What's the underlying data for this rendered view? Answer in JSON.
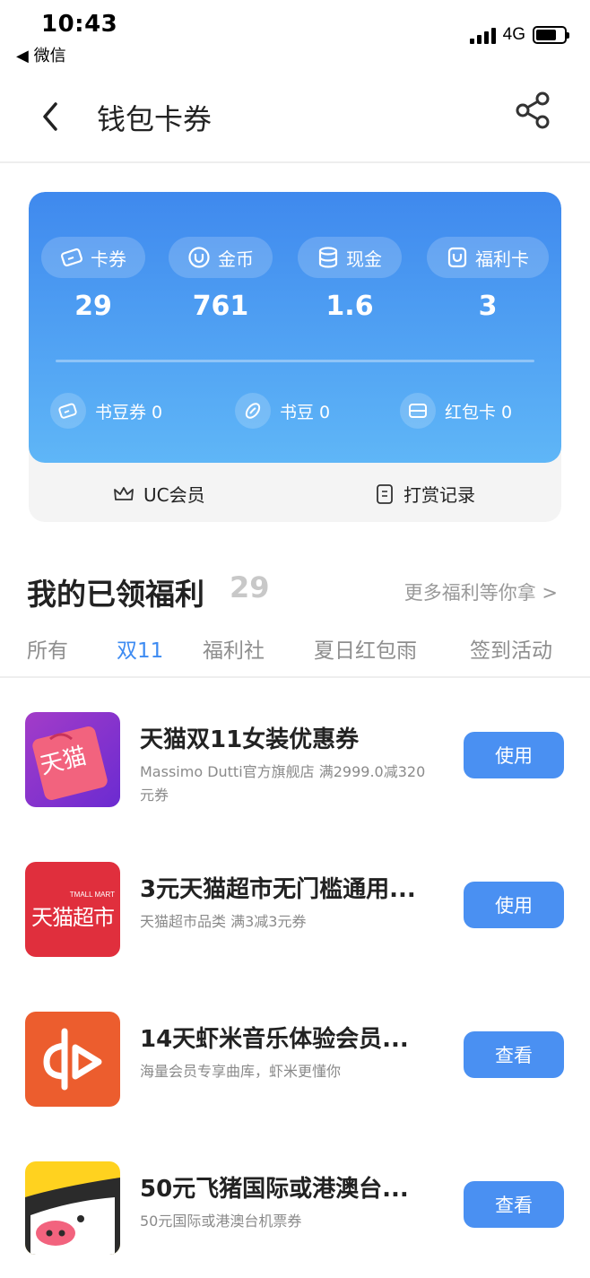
{
  "status_bar": {
    "time": "10:43",
    "back_app": "◀ 微信",
    "network": "4G"
  },
  "nav": {
    "title": "钱包卡券"
  },
  "summary": {
    "stats": [
      {
        "label": "卡券",
        "value": "29",
        "icon": "ticket-icon"
      },
      {
        "label": "金币",
        "value": "761",
        "icon": "coin-icon"
      },
      {
        "label": "现金",
        "value": "1.6",
        "icon": "cash-icon"
      },
      {
        "label": "福利卡",
        "value": "3",
        "icon": "welfare-card-icon"
      }
    ],
    "sub_items": [
      {
        "label": "书豆券 0",
        "icon": "bean-ticket-icon"
      },
      {
        "label": "书豆 0",
        "icon": "bean-icon"
      },
      {
        "label": "红包卡 0",
        "icon": "red-packet-card-icon"
      }
    ],
    "links": [
      {
        "label": "UC会员",
        "icon": "crown-icon"
      },
      {
        "label": "打赏记录",
        "icon": "reward-record-icon"
      }
    ]
  },
  "benefits": {
    "title": "我的已领福利",
    "count": "29",
    "more": "更多福利等你拿 >"
  },
  "tabs": [
    {
      "label": "所有",
      "active": false
    },
    {
      "label": "双11",
      "active": true
    },
    {
      "label": "福利社",
      "active": false
    },
    {
      "label": "夏日红包雨",
      "active": false
    },
    {
      "label": "签到活动",
      "active": false
    }
  ],
  "items": [
    {
      "title": "天猫双11女装优惠券",
      "desc": "Massimo Dutti官方旗舰店 满2999.0减320元券",
      "button": "使用",
      "thumb_text": "天猫"
    },
    {
      "title": "3元天猫超市无门槛通用...",
      "desc": "天猫超市品类 满3减3元券",
      "button": "使用",
      "thumb_text": "天猫超市",
      "thumb_small": "TMALL MART"
    },
    {
      "title": "14天虾米音乐体验会员...",
      "desc": "海量会员专享曲库，虾米更懂你",
      "button": "查看"
    },
    {
      "title": "50元飞猪国际或港澳台...",
      "desc": "50元国际或港澳台机票券",
      "button": "查看"
    }
  ],
  "colors": {
    "accent": "#3d8bf2",
    "card_top": "#3f89ee",
    "card_bottom": "#5fb6f7",
    "button": "#4a90f2"
  }
}
